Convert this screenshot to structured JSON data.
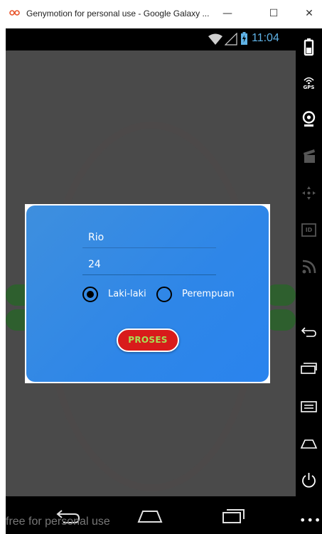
{
  "window": {
    "title": "Genymotion for personal use - Google Galaxy ...",
    "minimize": "—",
    "maximize": "☐",
    "close": "✕"
  },
  "statusbar": {
    "time": "11:04"
  },
  "dialog": {
    "name_value": "Rio",
    "age_value": "24",
    "gender_options": [
      "Laki-laki",
      "Perempuan"
    ],
    "selected_gender": "Laki-laki",
    "submit_label": "PROSES"
  },
  "sidebar": {
    "gps_label": "GPS",
    "id_label": "ID",
    "more": "•••"
  },
  "navbar": {
    "watermark": "free for personal use"
  },
  "colors": {
    "dialog_blue": "#2e86e8",
    "button_red": "#d81b1b",
    "button_text": "#a8e055",
    "clock_blue": "#5fb2e6"
  },
  "icons": [
    "genymotion-icon",
    "wifi-icon",
    "signal-icon",
    "battery-icon",
    "battery-icon",
    "gps-icon",
    "webcam-icon",
    "video-icon",
    "dpad-icon",
    "id-icon",
    "rss-icon",
    "back-icon",
    "home-icon",
    "recent-apps-icon",
    "menu-icon",
    "power-icon"
  ]
}
